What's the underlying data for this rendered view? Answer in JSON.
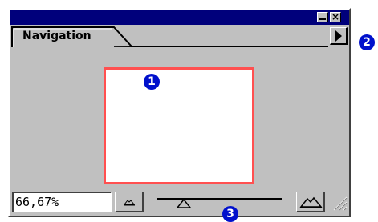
{
  "window": {
    "minimize_icon": "minimize-icon",
    "close_label": "×"
  },
  "tabs": [
    {
      "label": "Navigation",
      "active": true
    }
  ],
  "palette_menu_icon": "triangle-right-icon",
  "preview": {
    "border_color": "#ff5050",
    "frame_color": "#ffffff"
  },
  "callouts": [
    "1",
    "2",
    "3"
  ],
  "callout_color": "#0010cc",
  "zoom": {
    "value": "66,67%",
    "zoom_out_icon": "small-mountains-icon",
    "zoom_in_icon": "large-mountains-icon",
    "slider_icon": "slider-triangle-icon"
  },
  "titlebar_color": "#00007b",
  "panel_color": "#c0c0c0"
}
